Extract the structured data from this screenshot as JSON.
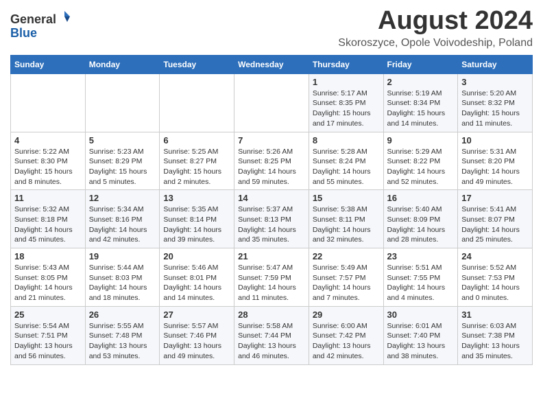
{
  "header": {
    "logo_line1": "General",
    "logo_line2": "Blue",
    "main_title": "August 2024",
    "subtitle": "Skoroszyce, Opole Voivodeship, Poland"
  },
  "columns": [
    "Sunday",
    "Monday",
    "Tuesday",
    "Wednesday",
    "Thursday",
    "Friday",
    "Saturday"
  ],
  "weeks": [
    [
      {
        "day": "",
        "detail": ""
      },
      {
        "day": "",
        "detail": ""
      },
      {
        "day": "",
        "detail": ""
      },
      {
        "day": "",
        "detail": ""
      },
      {
        "day": "1",
        "detail": "Sunrise: 5:17 AM\nSunset: 8:35 PM\nDaylight: 15 hours\nand 17 minutes."
      },
      {
        "day": "2",
        "detail": "Sunrise: 5:19 AM\nSunset: 8:34 PM\nDaylight: 15 hours\nand 14 minutes."
      },
      {
        "day": "3",
        "detail": "Sunrise: 5:20 AM\nSunset: 8:32 PM\nDaylight: 15 hours\nand 11 minutes."
      }
    ],
    [
      {
        "day": "4",
        "detail": "Sunrise: 5:22 AM\nSunset: 8:30 PM\nDaylight: 15 hours\nand 8 minutes."
      },
      {
        "day": "5",
        "detail": "Sunrise: 5:23 AM\nSunset: 8:29 PM\nDaylight: 15 hours\nand 5 minutes."
      },
      {
        "day": "6",
        "detail": "Sunrise: 5:25 AM\nSunset: 8:27 PM\nDaylight: 15 hours\nand 2 minutes."
      },
      {
        "day": "7",
        "detail": "Sunrise: 5:26 AM\nSunset: 8:25 PM\nDaylight: 14 hours\nand 59 minutes."
      },
      {
        "day": "8",
        "detail": "Sunrise: 5:28 AM\nSunset: 8:24 PM\nDaylight: 14 hours\nand 55 minutes."
      },
      {
        "day": "9",
        "detail": "Sunrise: 5:29 AM\nSunset: 8:22 PM\nDaylight: 14 hours\nand 52 minutes."
      },
      {
        "day": "10",
        "detail": "Sunrise: 5:31 AM\nSunset: 8:20 PM\nDaylight: 14 hours\nand 49 minutes."
      }
    ],
    [
      {
        "day": "11",
        "detail": "Sunrise: 5:32 AM\nSunset: 8:18 PM\nDaylight: 14 hours\nand 45 minutes."
      },
      {
        "day": "12",
        "detail": "Sunrise: 5:34 AM\nSunset: 8:16 PM\nDaylight: 14 hours\nand 42 minutes."
      },
      {
        "day": "13",
        "detail": "Sunrise: 5:35 AM\nSunset: 8:14 PM\nDaylight: 14 hours\nand 39 minutes."
      },
      {
        "day": "14",
        "detail": "Sunrise: 5:37 AM\nSunset: 8:13 PM\nDaylight: 14 hours\nand 35 minutes."
      },
      {
        "day": "15",
        "detail": "Sunrise: 5:38 AM\nSunset: 8:11 PM\nDaylight: 14 hours\nand 32 minutes."
      },
      {
        "day": "16",
        "detail": "Sunrise: 5:40 AM\nSunset: 8:09 PM\nDaylight: 14 hours\nand 28 minutes."
      },
      {
        "day": "17",
        "detail": "Sunrise: 5:41 AM\nSunset: 8:07 PM\nDaylight: 14 hours\nand 25 minutes."
      }
    ],
    [
      {
        "day": "18",
        "detail": "Sunrise: 5:43 AM\nSunset: 8:05 PM\nDaylight: 14 hours\nand 21 minutes."
      },
      {
        "day": "19",
        "detail": "Sunrise: 5:44 AM\nSunset: 8:03 PM\nDaylight: 14 hours\nand 18 minutes."
      },
      {
        "day": "20",
        "detail": "Sunrise: 5:46 AM\nSunset: 8:01 PM\nDaylight: 14 hours\nand 14 minutes."
      },
      {
        "day": "21",
        "detail": "Sunrise: 5:47 AM\nSunset: 7:59 PM\nDaylight: 14 hours\nand 11 minutes."
      },
      {
        "day": "22",
        "detail": "Sunrise: 5:49 AM\nSunset: 7:57 PM\nDaylight: 14 hours\nand 7 minutes."
      },
      {
        "day": "23",
        "detail": "Sunrise: 5:51 AM\nSunset: 7:55 PM\nDaylight: 14 hours\nand 4 minutes."
      },
      {
        "day": "24",
        "detail": "Sunrise: 5:52 AM\nSunset: 7:53 PM\nDaylight: 14 hours\nand 0 minutes."
      }
    ],
    [
      {
        "day": "25",
        "detail": "Sunrise: 5:54 AM\nSunset: 7:51 PM\nDaylight: 13 hours\nand 56 minutes."
      },
      {
        "day": "26",
        "detail": "Sunrise: 5:55 AM\nSunset: 7:48 PM\nDaylight: 13 hours\nand 53 minutes."
      },
      {
        "day": "27",
        "detail": "Sunrise: 5:57 AM\nSunset: 7:46 PM\nDaylight: 13 hours\nand 49 minutes."
      },
      {
        "day": "28",
        "detail": "Sunrise: 5:58 AM\nSunset: 7:44 PM\nDaylight: 13 hours\nand 46 minutes."
      },
      {
        "day": "29",
        "detail": "Sunrise: 6:00 AM\nSunset: 7:42 PM\nDaylight: 13 hours\nand 42 minutes."
      },
      {
        "day": "30",
        "detail": "Sunrise: 6:01 AM\nSunset: 7:40 PM\nDaylight: 13 hours\nand 38 minutes."
      },
      {
        "day": "31",
        "detail": "Sunrise: 6:03 AM\nSunset: 7:38 PM\nDaylight: 13 hours\nand 35 minutes."
      }
    ]
  ]
}
